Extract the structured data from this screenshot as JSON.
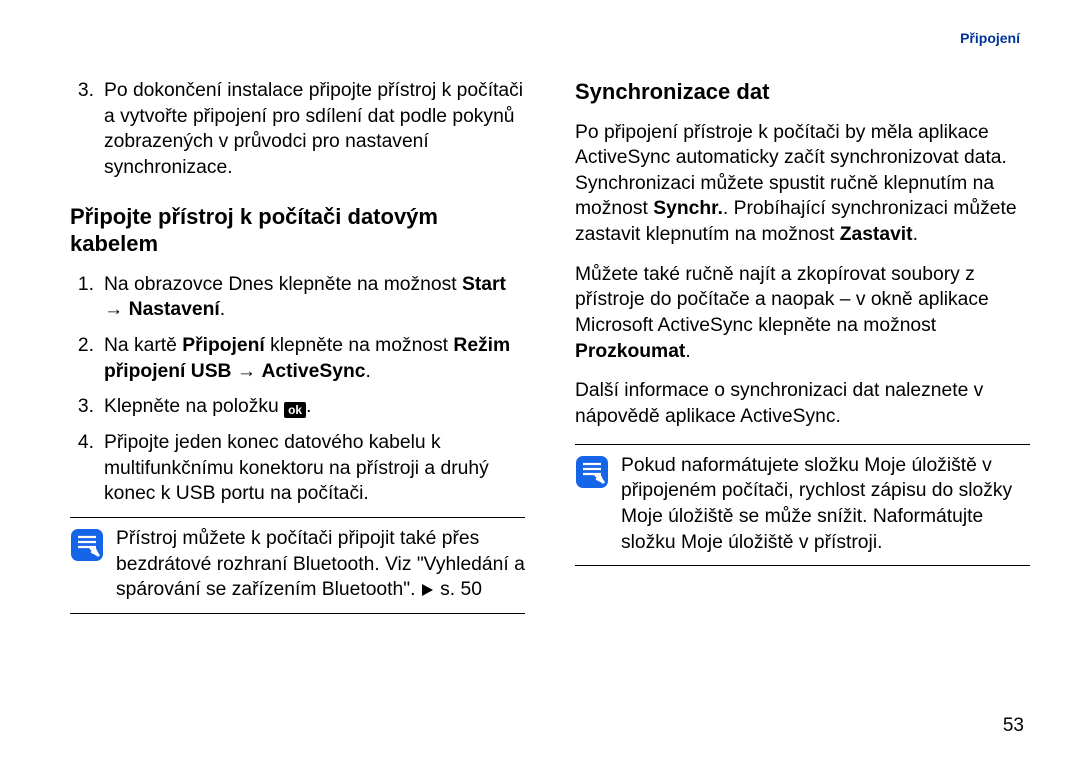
{
  "header": {
    "section": "Připojení"
  },
  "left": {
    "intro_list": [
      {
        "num": "3.",
        "text": "Po dokončení instalace připojte přístroj k počítači a vytvořte připojení pro sdílení dat podle pokynů zobrazených v průvodci pro nastavení synchronizace."
      }
    ],
    "heading": "Připojte přístroj k počítači datovým kabelem",
    "steps": [
      {
        "num": "1.",
        "pre": "Na obrazovce Dnes klepněte na možnost ",
        "bold_a": "Start",
        "arrow": " → ",
        "bold_b": "Nastavení",
        "post": "."
      },
      {
        "num": "2.",
        "pre": "Na kartě ",
        "bold_a": "Připojení",
        "mid": " klepněte na možnost ",
        "bold_b": "Režim připojení USB",
        "arrow": " → ",
        "bold_c": "ActiveSync",
        "post": "."
      },
      {
        "num": "3.",
        "pre": "Klepněte na položku ",
        "icon": "ok",
        "post": "."
      },
      {
        "num": "4.",
        "text": "Připojte jeden konec datového kabelu k multifunkčnímu konektoru na přístroji a druhý konec k USB portu na počítači."
      }
    ],
    "note": {
      "line1": "Přístroj můžete k počítači připojit také přes bezdrátové rozhraní Bluetooth. Viz \"Vyhledání a spárování se zařízením Bluetooth\". ",
      "tri": true,
      "tail": " s. 50"
    }
  },
  "right": {
    "heading": "Synchronizace dat",
    "p1": {
      "a": "Po připojení přístroje k počítači by měla aplikace ActiveSync automaticky začít synchronizovat data. Synchronizaci můžete spustit ručně klepnutím na možnost ",
      "b1": "Synchr.",
      "b": ". Probíhající synchronizaci můžete zastavit klepnutím na možnost ",
      "b2": "Zastavit",
      "c": "."
    },
    "p2": {
      "a": "Můžete také ručně najít a zkopírovat soubory z přístroje do počítače a naopak – v okně aplikace Microsoft ActiveSync klepněte na možnost ",
      "b1": "Prozkoumat",
      "c": "."
    },
    "p3": "Další informace o synchronizaci dat naleznete v nápovědě aplikace ActiveSync.",
    "note": "Pokud naformátujete složku Moje úložiště v připojeném počítači, rychlost zápisu do složky Moje úložiště se může snížit. Naformátujte složku Moje úložiště v přístroji."
  },
  "page_number": "53"
}
